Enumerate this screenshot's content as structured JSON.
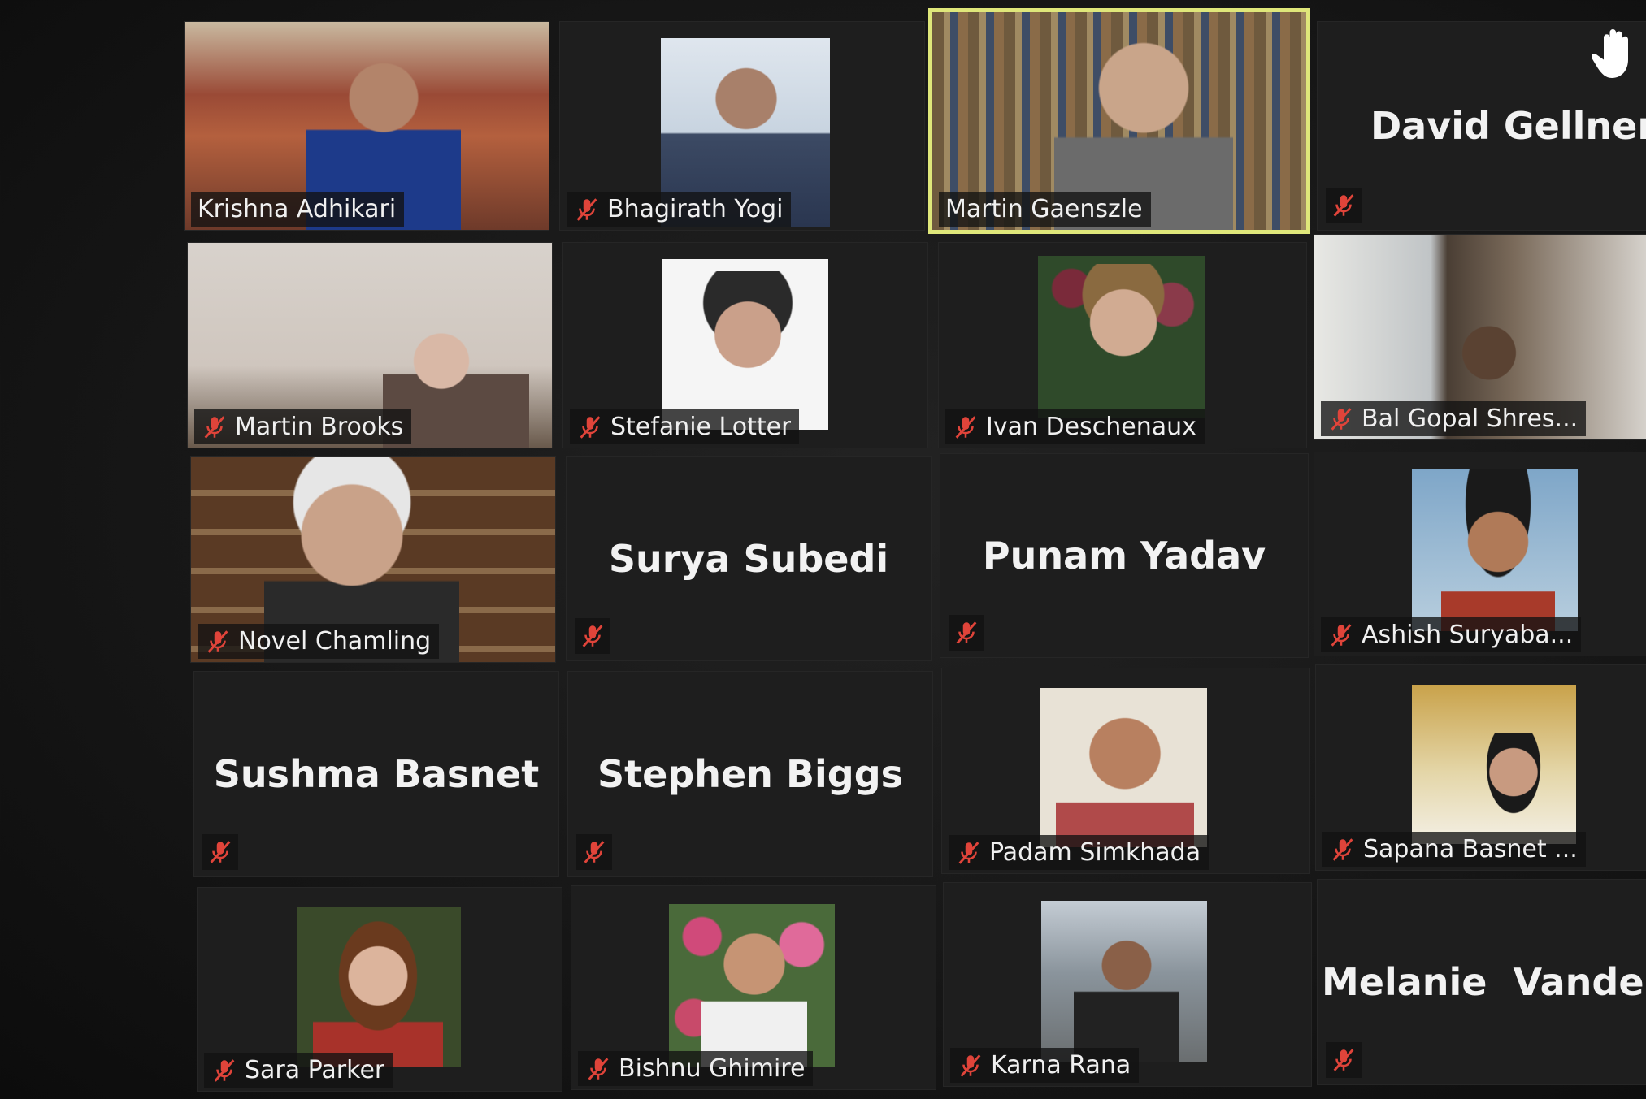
{
  "participants": [
    {
      "name": "Krishna Adhikari",
      "muted": false
    },
    {
      "name": "Bhagirath Yogi",
      "muted": true
    },
    {
      "name": "Martin Gaenszle",
      "muted": false,
      "active_speaker": true
    },
    {
      "name": "David Gellner",
      "muted": true
    },
    {
      "name": "Martin Brooks",
      "muted": true
    },
    {
      "name": "Stefanie Lotter",
      "muted": true
    },
    {
      "name": "Ivan Deschenaux",
      "muted": true
    },
    {
      "name": "Bal Gopal Shres...",
      "muted": true
    },
    {
      "name": "Novel Chamling",
      "muted": true
    },
    {
      "name": "Surya Subedi",
      "muted": true
    },
    {
      "name": "Punam Yadav",
      "muted": true
    },
    {
      "name": "Ashish Suryaba...",
      "muted": true
    },
    {
      "name": "Sushma Basnet",
      "muted": true
    },
    {
      "name": "Stephen Biggs",
      "muted": true
    },
    {
      "name": "Padam Simkhada",
      "muted": true
    },
    {
      "name": "Sapana Basnet ...",
      "muted": true
    },
    {
      "name": "Sara Parker",
      "muted": true
    },
    {
      "name": "Bishnu Ghimire",
      "muted": true
    },
    {
      "name": "Karna Rana",
      "muted": true
    },
    {
      "name": "Melanie  Vanden...",
      "muted": true
    }
  ],
  "colors": {
    "active_border": "#dfe77a",
    "mute_icon": "#e0443a",
    "tile_bg": "#1e1e1e",
    "raise_hand": "#ffffff"
  },
  "icons": {
    "mute": "microphone-muted-icon",
    "hand": "raised-hand-icon"
  }
}
